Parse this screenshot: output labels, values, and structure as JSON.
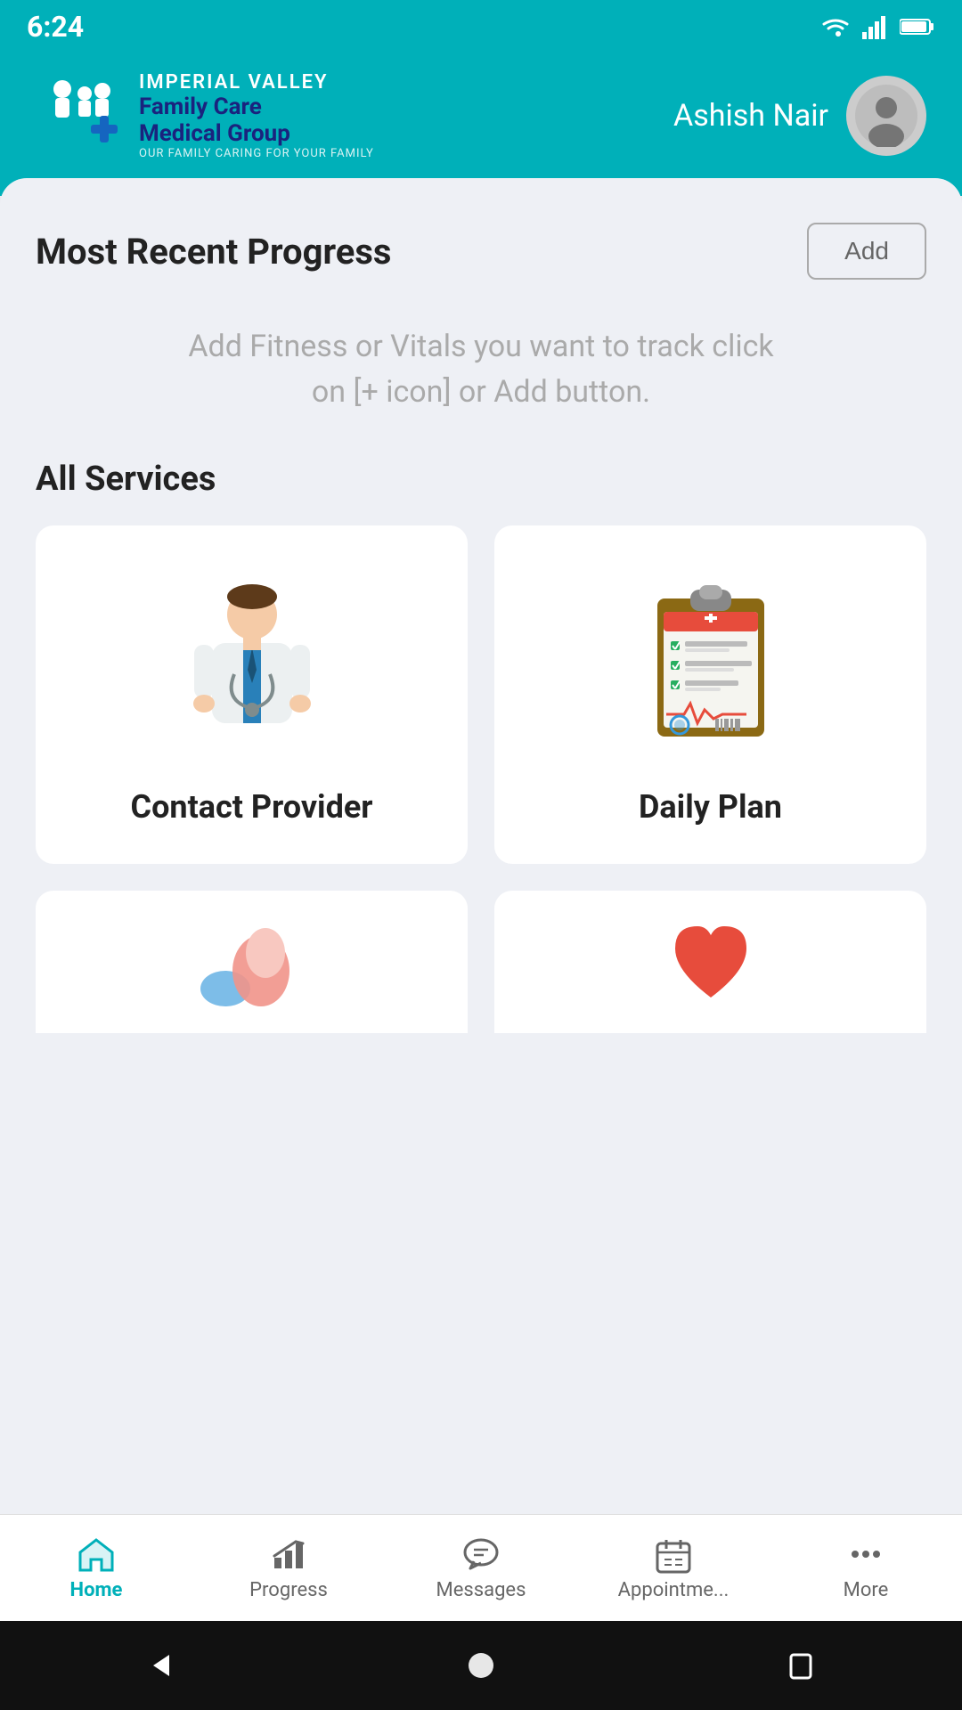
{
  "statusBar": {
    "time": "6:24",
    "icons": [
      "sim-card-icon",
      "wifi-icon",
      "signal-icon",
      "battery-icon"
    ]
  },
  "header": {
    "logoTextTop": "IMPERIAL VALLEY",
    "logoTextMid": "Family Care",
    "logoTextMid2": "Medical Group",
    "logoTagline": "OUR FAMILY CARING FOR YOUR FAMILY",
    "userName": "Ashish Nair"
  },
  "progressSection": {
    "title": "Most Recent Progress",
    "addButton": "Add",
    "emptyText": "Add Fitness or Vitals you want to track click on [+ icon] or Add button."
  },
  "servicesSection": {
    "title": "All Services",
    "services": [
      {
        "id": "contact-provider",
        "label": "Contact Provider"
      },
      {
        "id": "daily-plan",
        "label": "Daily Plan"
      }
    ]
  },
  "bottomNav": {
    "items": [
      {
        "id": "home",
        "label": "Home",
        "active": true
      },
      {
        "id": "progress",
        "label": "Progress",
        "active": false
      },
      {
        "id": "messages",
        "label": "Messages",
        "active": false
      },
      {
        "id": "appointments",
        "label": "Appointme...",
        "active": false
      },
      {
        "id": "more",
        "label": "More",
        "active": false
      }
    ]
  }
}
